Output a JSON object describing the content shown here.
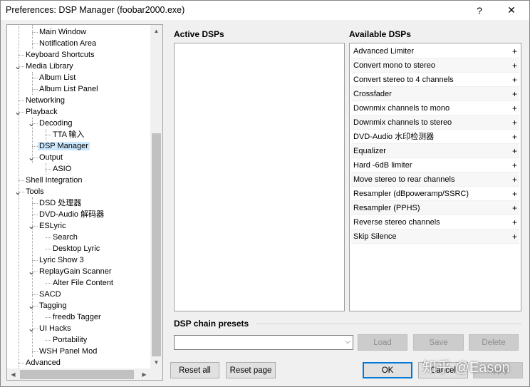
{
  "window": {
    "title": "Preferences: DSP Manager (foobar2000.exe)",
    "help_glyph": "?",
    "close_glyph": "✕"
  },
  "tree": {
    "items": [
      {
        "label": "Main Window",
        "level": 2,
        "expander": ""
      },
      {
        "label": "Notification Area",
        "level": 2,
        "expander": ""
      },
      {
        "label": "Keyboard Shortcuts",
        "level": 1,
        "expander": ""
      },
      {
        "label": "Media Library",
        "level": 1,
        "expander": "v"
      },
      {
        "label": "Album List",
        "level": 2,
        "expander": ""
      },
      {
        "label": "Album List Panel",
        "level": 2,
        "expander": ""
      },
      {
        "label": "Networking",
        "level": 1,
        "expander": ""
      },
      {
        "label": "Playback",
        "level": 1,
        "expander": "v"
      },
      {
        "label": "Decoding",
        "level": 2,
        "expander": "v"
      },
      {
        "label": "TTA 输入",
        "level": 3,
        "expander": ""
      },
      {
        "label": "DSP Manager",
        "level": 2,
        "expander": "",
        "selected": true
      },
      {
        "label": "Output",
        "level": 2,
        "expander": "v"
      },
      {
        "label": "ASIO",
        "level": 3,
        "expander": ""
      },
      {
        "label": "Shell Integration",
        "level": 1,
        "expander": ""
      },
      {
        "label": "Tools",
        "level": 1,
        "expander": "v"
      },
      {
        "label": "DSD 处理器",
        "level": 2,
        "expander": ""
      },
      {
        "label": "DVD-Audio 解码器",
        "level": 2,
        "expander": ""
      },
      {
        "label": "ESLyric",
        "level": 2,
        "expander": "v"
      },
      {
        "label": "Search",
        "level": 3,
        "expander": ""
      },
      {
        "label": "Desktop Lyric",
        "level": 3,
        "expander": ""
      },
      {
        "label": "Lyric Show 3",
        "level": 2,
        "expander": ""
      },
      {
        "label": "ReplayGain Scanner",
        "level": 2,
        "expander": "v"
      },
      {
        "label": "Alter File Content",
        "level": 3,
        "expander": ""
      },
      {
        "label": "SACD",
        "level": 2,
        "expander": ""
      },
      {
        "label": "Tagging",
        "level": 2,
        "expander": "v"
      },
      {
        "label": "freedb Tagger",
        "level": 3,
        "expander": ""
      },
      {
        "label": "UI Hacks",
        "level": 2,
        "expander": "v"
      },
      {
        "label": "Portability",
        "level": 3,
        "expander": ""
      },
      {
        "label": "WSH Panel Mod",
        "level": 2,
        "expander": ""
      },
      {
        "label": "Advanced",
        "level": 1,
        "expander": ""
      }
    ],
    "scroll_up": "▲",
    "scroll_down": "▼",
    "scroll_left": "◀",
    "scroll_right": "▶"
  },
  "active": {
    "heading": "Active DSPs",
    "items": []
  },
  "available": {
    "heading": "Available DSPs",
    "add_glyph": "+",
    "items": [
      "Advanced Limiter",
      "Convert mono to stereo",
      "Convert stereo to 4 channels",
      "Crossfader",
      "Downmix channels to mono",
      "Downmix channels to stereo",
      "DVD-Audio 水印检测器",
      "Equalizer",
      "Hard -6dB limiter",
      "Move stereo to rear channels",
      "Resampler (dBpoweramp/SSRC)",
      "Resampler (PPHS)",
      "Reverse stereo channels",
      "Skip Silence"
    ]
  },
  "presets": {
    "heading": "DSP chain presets",
    "combo_value": "",
    "combo_arrow": "⌵",
    "load": "Load",
    "save": "Save",
    "delete": "Delete"
  },
  "footer": {
    "reset_all": "Reset all",
    "reset_page": "Reset page",
    "ok": "OK",
    "cancel": "Cancel",
    "apply": "Apply"
  },
  "watermark": "知乎 @Eason"
}
